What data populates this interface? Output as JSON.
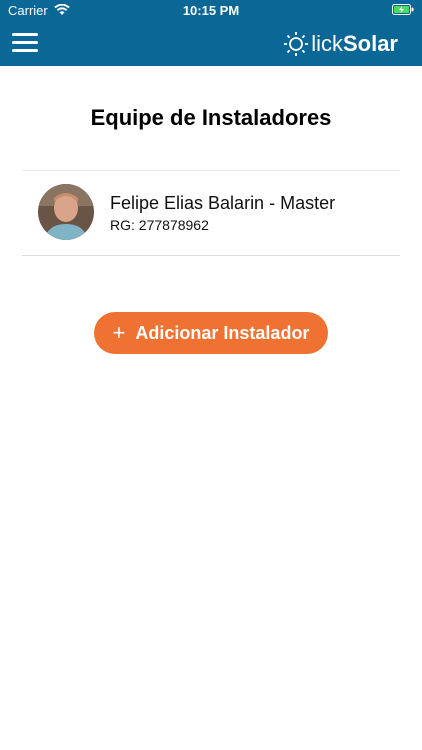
{
  "status_bar": {
    "carrier": "Carrier",
    "time": "10:15 PM",
    "battery_icon": "battery-charging-icon",
    "wifi_icon": "wifi-icon"
  },
  "header": {
    "menu_icon": "hamburger-menu-icon",
    "logo_light": "lick",
    "logo_bold": "Solar",
    "logo_icon": "sun-icon",
    "background": "#0b6796"
  },
  "page": {
    "title": "Equipe de Instaladores"
  },
  "installers": [
    {
      "name": "Felipe Elias Balarin - Master",
      "rg": "RG: 277878962",
      "avatar": "avatar-photo"
    }
  ],
  "actions": {
    "add_label": "Adicionar Instalador",
    "add_icon": "plus-icon",
    "accent": "#f07233"
  }
}
